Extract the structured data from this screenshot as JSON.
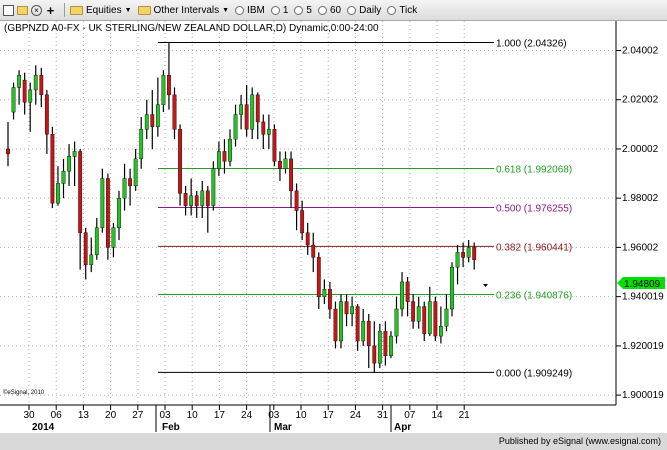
{
  "toolbar": {
    "items": [
      "Equities",
      "Other Intervals",
      "IBM",
      "1",
      "5",
      "60",
      "Daily",
      "Tick"
    ]
  },
  "chart_data": {
    "type": "candlestick",
    "title": "(GBPNZD A0-FX - UK STERLING/NEW ZEALAND DOLLAR,D) Dynamic,0:00-24:00",
    "ylim": [
      1.896,
      2.052
    ],
    "y_ticks": [
      "2.04002",
      "2.02002",
      "2.00002",
      "1.98002",
      "1.96002",
      "1.940019",
      "1.920019",
      "1.900019"
    ],
    "x_day_labels": [
      "30",
      "06",
      "13",
      "20",
      "27",
      "03",
      "10",
      "17",
      "24",
      "03",
      "10",
      "17",
      "24",
      "31",
      "07",
      "14",
      "21"
    ],
    "x_month_labels": [
      "2014",
      "Feb",
      "Mar",
      "Apr"
    ],
    "last_price": "1.94809",
    "watermark": "©eSignal, 2010",
    "fibonacci": [
      {
        "label": "1.000 (2.04326)",
        "value": 2.04326,
        "color": "#000000"
      },
      {
        "label": "0.618 (1.992068)",
        "value": 1.992068,
        "color": "#22a022"
      },
      {
        "label": "0.500 (1.976255)",
        "value": 1.976255,
        "color": "#8b1a8b"
      },
      {
        "label": "0.382 (1.960441)",
        "value": 1.960441,
        "color": "#8b1a1a"
      },
      {
        "label": "0.236 (1.940876)",
        "value": 1.940876,
        "color": "#22a022"
      },
      {
        "label": "0.000 (1.909249)",
        "value": 1.909249,
        "color": "#000000"
      }
    ],
    "candles": [
      [
        2.0,
        1.998,
        2.011,
        1.993
      ],
      [
        2.015,
        2.025,
        2.027,
        2.012
      ],
      [
        2.025,
        2.03,
        2.032,
        2.018
      ],
      [
        2.028,
        2.019,
        2.031,
        2.014
      ],
      [
        2.019,
        2.024,
        2.027,
        2.007
      ],
      [
        2.024,
        2.03,
        2.034,
        2.018
      ],
      [
        2.03,
        2.022,
        2.033,
        2.017
      ],
      [
        2.022,
        2.006,
        2.024,
        1.998
      ],
      [
        2.006,
        1.978,
        2.009,
        1.976
      ],
      [
        1.978,
        1.986,
        1.993,
        1.977
      ],
      [
        1.986,
        1.991,
        1.996,
        1.98
      ],
      [
        1.991,
        1.997,
        2.002,
        1.985
      ],
      [
        1.997,
        1.999,
        2.003,
        1.985
      ],
      [
        1.999,
        1.966,
        2.0,
        1.951
      ],
      [
        1.966,
        1.953,
        1.968,
        1.947
      ],
      [
        1.953,
        1.957,
        1.964,
        1.95
      ],
      [
        1.957,
        1.968,
        1.972,
        1.955
      ],
      [
        1.968,
        1.988,
        1.992,
        1.966
      ],
      [
        1.988,
        1.96,
        1.99,
        1.955
      ],
      [
        1.96,
        1.968,
        1.97,
        1.956
      ],
      [
        1.968,
        1.98,
        1.983,
        1.963
      ],
      [
        1.98,
        1.988,
        1.994,
        1.975
      ],
      [
        1.988,
        1.985,
        1.992,
        1.977
      ],
      [
        1.985,
        1.996,
        2.0,
        1.983
      ],
      [
        1.996,
        2.008,
        2.013,
        1.992
      ],
      [
        2.008,
        2.014,
        2.02,
        2.004
      ],
      [
        2.014,
        2.009,
        2.024,
        2.0
      ],
      [
        2.009,
        2.018,
        2.029,
        2.005
      ],
      [
        2.018,
        2.03,
        2.032,
        2.015
      ],
      [
        2.03,
        2.022,
        2.043,
        2.016
      ],
      [
        2.022,
        2.008,
        2.025,
        2.004
      ],
      [
        2.008,
        1.982,
        2.01,
        1.977
      ],
      [
        1.982,
        1.977,
        1.985,
        1.973
      ],
      [
        1.977,
        1.981,
        1.988,
        1.973
      ],
      [
        1.981,
        1.977,
        1.983,
        1.972
      ],
      [
        1.977,
        1.983,
        1.987,
        1.972
      ],
      [
        1.983,
        1.977,
        1.985,
        1.966
      ],
      [
        1.977,
        1.992,
        1.995,
        1.975
      ],
      [
        1.992,
        1.999,
        2.003,
        1.989
      ],
      [
        1.999,
        1.995,
        2.004,
        1.99
      ],
      [
        1.995,
        2.004,
        2.008,
        1.993
      ],
      [
        2.004,
        2.014,
        2.018,
        2.001
      ],
      [
        2.014,
        2.018,
        2.022,
        2.008
      ],
      [
        2.018,
        2.008,
        2.026,
        2.005
      ],
      [
        2.008,
        2.022,
        2.025,
        2.004
      ],
      [
        2.022,
        2.011,
        2.023,
        2.004
      ],
      [
        2.011,
        2.006,
        2.014,
        2.0
      ],
      [
        2.006,
        2.008,
        2.014,
        2.0
      ],
      [
        2.008,
        1.995,
        2.01,
        1.993
      ],
      [
        1.995,
        1.992,
        1.999,
        1.987
      ],
      [
        1.992,
        1.996,
        1.999,
        1.99
      ],
      [
        1.996,
        1.983,
        1.999,
        1.976
      ],
      [
        1.983,
        1.975,
        1.986,
        1.967
      ],
      [
        1.975,
        1.966,
        1.979,
        1.963
      ],
      [
        1.966,
        1.961,
        1.97,
        1.957
      ],
      [
        1.961,
        1.956,
        1.966,
        1.95
      ],
      [
        1.956,
        1.94,
        1.958,
        1.935
      ],
      [
        1.94,
        1.943,
        1.947,
        1.937
      ],
      [
        1.943,
        1.935,
        1.946,
        1.931
      ],
      [
        1.935,
        1.922,
        1.938,
        1.919
      ],
      [
        1.922,
        1.938,
        1.941,
        1.919
      ],
      [
        1.938,
        1.933,
        1.941,
        1.928
      ],
      [
        1.933,
        1.936,
        1.94,
        1.928
      ],
      [
        1.936,
        1.922,
        1.937,
        1.918
      ],
      [
        1.922,
        1.93,
        1.935,
        1.92
      ],
      [
        1.93,
        1.92,
        1.933,
        1.911
      ],
      [
        1.92,
        1.913,
        1.93,
        1.909
      ],
      [
        1.913,
        1.926,
        1.929,
        1.911
      ],
      [
        1.926,
        1.916,
        1.93,
        1.912
      ],
      [
        1.916,
        1.924,
        1.926,
        1.915
      ],
      [
        1.924,
        1.935,
        1.94,
        1.921
      ],
      [
        1.935,
        1.946,
        1.95,
        1.932
      ],
      [
        1.946,
        1.938,
        1.948,
        1.932
      ],
      [
        1.938,
        1.93,
        1.941,
        1.927
      ],
      [
        1.93,
        1.936,
        1.94,
        1.927
      ],
      [
        1.936,
        1.925,
        1.938,
        1.922
      ],
      [
        1.925,
        1.938,
        1.944,
        1.924
      ],
      [
        1.938,
        1.924,
        1.94,
        1.922
      ],
      [
        1.924,
        1.928,
        1.936,
        1.921
      ],
      [
        1.928,
        1.935,
        1.941,
        1.926
      ],
      [
        1.935,
        1.952,
        1.954,
        1.932
      ],
      [
        1.952,
        1.958,
        1.961,
        1.945
      ],
      [
        1.958,
        1.956,
        1.962,
        1.952
      ],
      [
        1.956,
        1.96,
        1.963,
        1.954
      ],
      [
        1.96,
        1.955,
        1.962,
        1.951
      ]
    ]
  }
}
